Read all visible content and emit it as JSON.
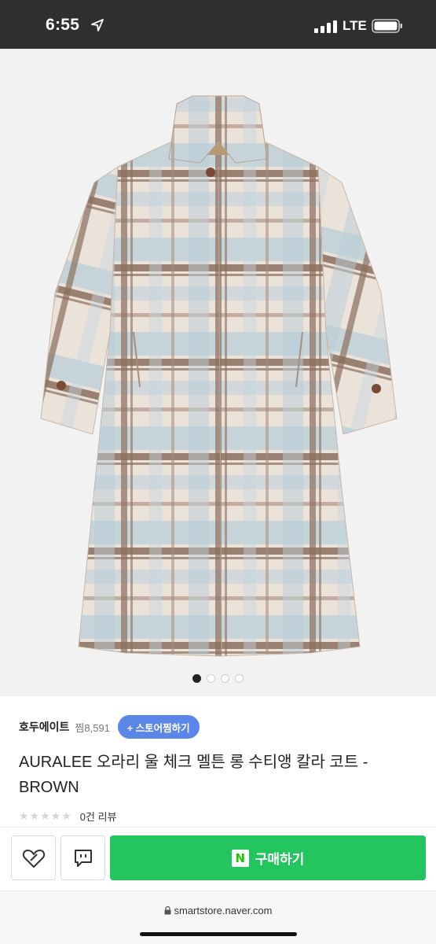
{
  "status_bar": {
    "time": "6:55",
    "network": "LTE",
    "icons": [
      "location-arrow-icon",
      "signal-bars-icon",
      "battery-icon"
    ]
  },
  "product_image": {
    "carousel_pages": 4,
    "active_page": 1
  },
  "store": {
    "name": "호두에이트",
    "fav_count": "찜8,591",
    "fav_button": "+ 스토어찜하기"
  },
  "product": {
    "title": "AURALEE 오라리 울 체크 멜튼 롱 수티앵 칼라 코트 - BROWN",
    "rating_stars": "★★★★★",
    "review_count": "0건 리뷰"
  },
  "actions": {
    "buy_badge": "N",
    "buy_label": "구매하기",
    "wish_icon": "heart-icon",
    "talk_icon": "talk-bubble-icon"
  },
  "browser": {
    "url": "smartstore.naver.com"
  },
  "colors": {
    "status_bar_bg": "#2e2f31",
    "fav_button_bg": "#5a86e8",
    "buy_button_bg": "#22c55e"
  }
}
